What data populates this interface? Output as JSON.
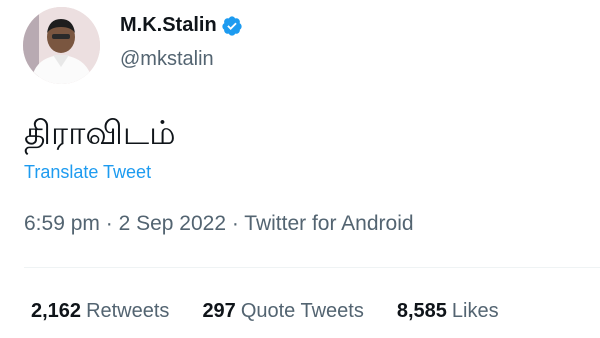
{
  "author": {
    "name": "M.K.Stalin",
    "handle": "@mkstalin",
    "verified": true,
    "avatar_icon": "profile-photo"
  },
  "tweet": {
    "text": "திராவிடம்",
    "translate_label": "Translate Tweet"
  },
  "meta": {
    "time": "6:59 pm",
    "separator": "·",
    "date": "2 Sep 2022",
    "source": "Twitter for Android"
  },
  "stats": {
    "retweets_count": "2,162",
    "retweets_label": "Retweets",
    "quotes_count": "297",
    "quotes_label": "Quote Tweets",
    "likes_count": "8,585",
    "likes_label": "Likes"
  },
  "colors": {
    "accent": "#1d9bf0",
    "secondary_text": "#536471",
    "primary_text": "#0f1419"
  }
}
